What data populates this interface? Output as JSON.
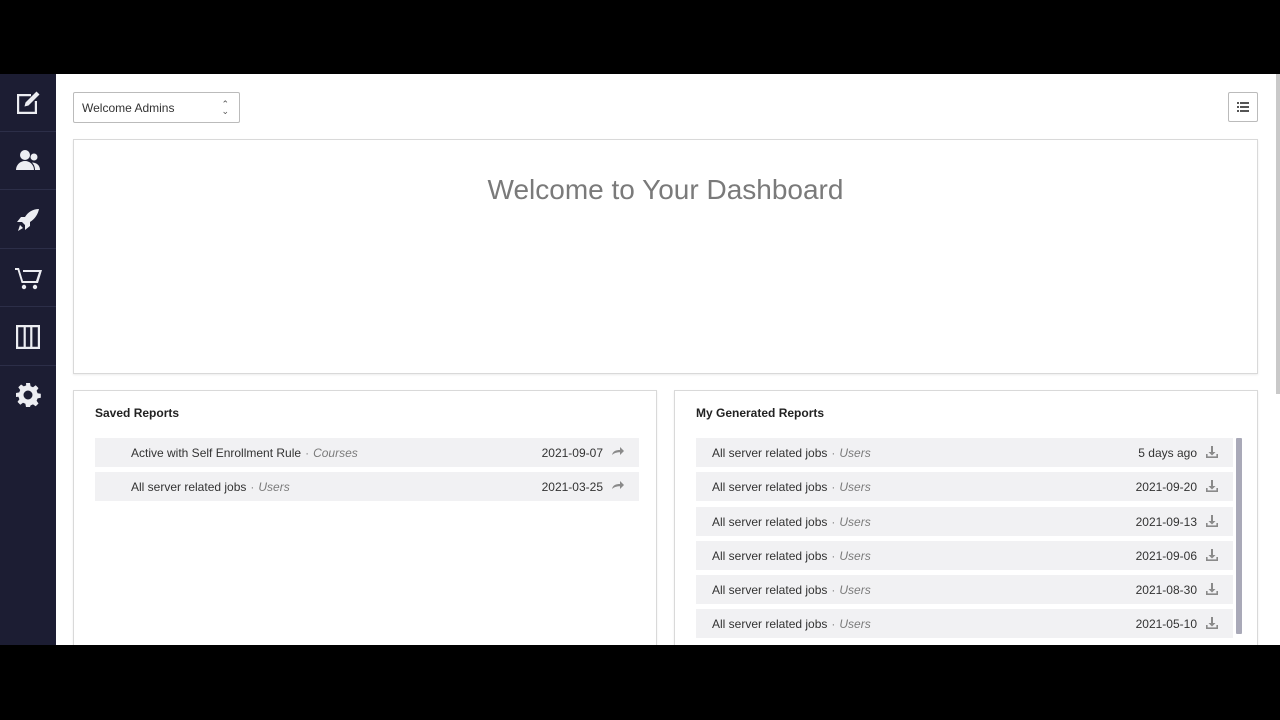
{
  "sidebar": {
    "items": [
      {
        "icon": "edit-icon"
      },
      {
        "icon": "users-icon"
      },
      {
        "icon": "rocket-icon"
      },
      {
        "icon": "cart-icon"
      },
      {
        "icon": "columns-icon"
      },
      {
        "icon": "gear-icon"
      }
    ],
    "bg_color": "#1c1d33"
  },
  "dashboard_select": {
    "selected": "Welcome Admins"
  },
  "welcome_panel": {
    "title": "Welcome to Your Dashboard"
  },
  "saved_reports": {
    "title": "Saved Reports",
    "rows": [
      {
        "name": "Active with Self Enrollment Rule",
        "separator": "·",
        "type": "Courses",
        "date": "2021-09-07"
      },
      {
        "name": "All server related jobs",
        "separator": "·",
        "type": "Users",
        "date": "2021-03-25"
      }
    ]
  },
  "generated_reports": {
    "title": "My Generated Reports",
    "rows": [
      {
        "name": "All server related jobs",
        "separator": "·",
        "type": "Users",
        "date": "5 days ago"
      },
      {
        "name": "All server related jobs",
        "separator": "·",
        "type": "Users",
        "date": "2021-09-20"
      },
      {
        "name": "All server related jobs",
        "separator": "·",
        "type": "Users",
        "date": "2021-09-13"
      },
      {
        "name": "All server related jobs",
        "separator": "·",
        "type": "Users",
        "date": "2021-09-06"
      },
      {
        "name": "All server related jobs",
        "separator": "·",
        "type": "Users",
        "date": "2021-08-30"
      },
      {
        "name": "All server related jobs",
        "separator": "·",
        "type": "Users",
        "date": "2021-05-10"
      }
    ]
  }
}
